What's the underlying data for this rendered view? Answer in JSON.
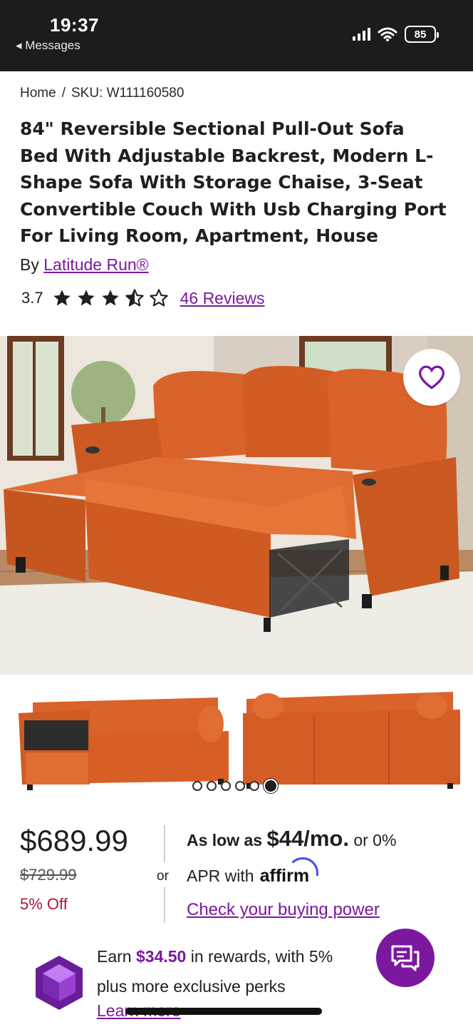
{
  "status_bar": {
    "time": "19:37",
    "back_label": "◂ Messages",
    "battery": "85"
  },
  "breadcrumb": {
    "home": "Home",
    "separator": "/",
    "sku": "SKU: W111160580"
  },
  "product": {
    "title": "84\" Reversible Sectional Pull-Out Sofa Bed With Adjustable Backrest, Modern L-Shape Sofa With Storage Chaise, 3-Seat Convertible Couch With Usb Charging Port For Living Room, Apartment, House",
    "by_label": "By",
    "brand": "Latitude Run®",
    "rating": "3.7",
    "rating_out_of_5": 3.7,
    "reviews_link": "46 Reviews",
    "image_count": 6,
    "active_image_index": 5
  },
  "pricing": {
    "price": "$689.99",
    "was_price": "$729.99",
    "discount": "5% Off",
    "or_label": "or",
    "financing_prefix": "As low as",
    "financing_amount": "$44/mo.",
    "financing_suffix": "or 0%",
    "apr_label": "APR with",
    "affirm_logo": "affirm",
    "buying_power_link": "Check your buying power"
  },
  "rewards": {
    "earn_label": "Earn",
    "amount": "$34.50",
    "line1_suffix": "in rewards, with 5%",
    "line2": "plus more exclusive perks",
    "learn_more": "Learn more"
  },
  "colors": {
    "accent_purple": "#7b189f",
    "discount_red": "#a5193b",
    "sofa_orange": "#d9632a",
    "status_bar": "#1c1c1c"
  },
  "icons": {
    "favorite": "heart-icon",
    "chat": "chat-bubbles-icon",
    "rewards": "purple-gem-icon"
  }
}
